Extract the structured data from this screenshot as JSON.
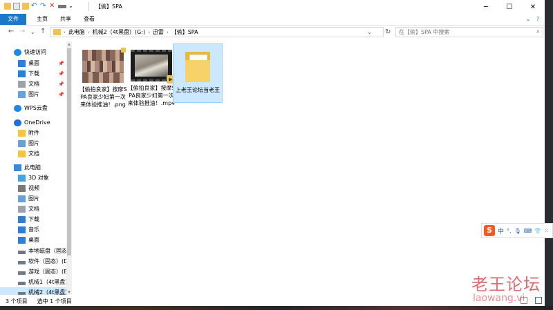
{
  "window": {
    "title": "【偷】SPA",
    "minimize_glyph": "─",
    "maximize_glyph": "☐",
    "close_glyph": "✕"
  },
  "ribbon": {
    "tabs": [
      "文件",
      "主页",
      "共享",
      "查看"
    ],
    "expand_glyph": "⌄",
    "help_glyph": "?"
  },
  "address": {
    "back_glyph": "←",
    "forward_glyph": "→",
    "recent_glyph": "⌄",
    "up_glyph": "↑",
    "crumbs": [
      "此电脑",
      "机械2（4t黑盘）(G:)",
      "迅雷",
      "【偷】SPA"
    ],
    "dropdown_glyph": "⌄",
    "refresh_glyph": "↻",
    "search_placeholder": "在【偷】SPA 中搜索",
    "search_glyph": "⌕"
  },
  "nav": {
    "items": [
      {
        "label": "快速访问",
        "icon": "star-icon",
        "color": "#1e88e5"
      },
      {
        "label": "桌面",
        "icon": "desktop-icon",
        "color": "#2f7ed8",
        "pinned": true
      },
      {
        "label": "下载",
        "icon": "download-icon",
        "color": "#2f7ed8",
        "pinned": true
      },
      {
        "label": "文档",
        "icon": "document-icon",
        "color": "#9aa4b0",
        "pinned": true
      },
      {
        "label": "图片",
        "icon": "picture-icon",
        "color": "#6aa0d8",
        "pinned": true
      },
      {
        "label": "WPS云盘",
        "icon": "cloud-icon",
        "color": "#1e88e5"
      },
      {
        "label": "OneDrive",
        "icon": "cloud-icon",
        "color": "#1e6fd9"
      },
      {
        "label": "附件",
        "icon": "folder-icon",
        "color": "#f3c44d"
      },
      {
        "label": "图片",
        "icon": "picture-icon",
        "color": "#6aa0d8"
      },
      {
        "label": "文档",
        "icon": "folder-icon",
        "color": "#f3c44d"
      },
      {
        "label": "此电脑",
        "icon": "computer-icon",
        "color": "#3a8ad8"
      },
      {
        "label": "3D 对象",
        "icon": "3d-objects-icon",
        "color": "#4aa3df"
      },
      {
        "label": "视频",
        "icon": "video-icon",
        "color": "#7a7a7a"
      },
      {
        "label": "图片",
        "icon": "picture-icon",
        "color": "#6aa0d8"
      },
      {
        "label": "文档",
        "icon": "document-icon",
        "color": "#9aa4b0"
      },
      {
        "label": "下载",
        "icon": "download-icon",
        "color": "#2f7ed8"
      },
      {
        "label": "音乐",
        "icon": "music-icon",
        "color": "#2f7ed8"
      },
      {
        "label": "桌面",
        "icon": "desktop-icon",
        "color": "#2f7ed8"
      },
      {
        "label": "本地磁盘（固态",
        "icon": "drive-icon",
        "color": "#6e7a86"
      },
      {
        "label": "软件（固态）(D",
        "icon": "drive-icon",
        "color": "#6e7a86"
      },
      {
        "label": "游戏（固态）(E",
        "icon": "drive-icon",
        "color": "#6e7a86"
      },
      {
        "label": "机械1（4t黑盘）",
        "icon": "drive-icon",
        "color": "#6e7a86"
      },
      {
        "label": "机械2（4t黑盘）",
        "icon": "drive-icon",
        "color": "#6e7a86"
      }
    ],
    "pin_glyph": "📌",
    "scroll_up_glyph": "▴",
    "scroll_down_glyph": "▾"
  },
  "files": [
    {
      "name": "【偷拍良家】按摩SPA良家少妇第一次来体验推油！.png",
      "type": "image"
    },
    {
      "name": "【偷拍良家】按摩SPA良家少妇第一次来体验推油！.mp4",
      "type": "video"
    },
    {
      "name": "上老王论坛当老王",
      "type": "folder"
    }
  ],
  "status": {
    "count": "3 个项目",
    "selected": "选中 1 个项目"
  },
  "ime": {
    "logo": "S",
    "mode": "中",
    "punct": "°,",
    "mic_glyph": "🎙",
    "keyboard_glyph": "⌨",
    "shirt_glyph": "👕",
    "grid_glyph": "⁙"
  },
  "watermark": {
    "title": "老王论坛",
    "url": "laowang.vi"
  },
  "colors": {
    "accent": "#1979ca",
    "selection": "#cce8ff",
    "folder": "#f3c44d",
    "watermark": "#d2323c"
  }
}
